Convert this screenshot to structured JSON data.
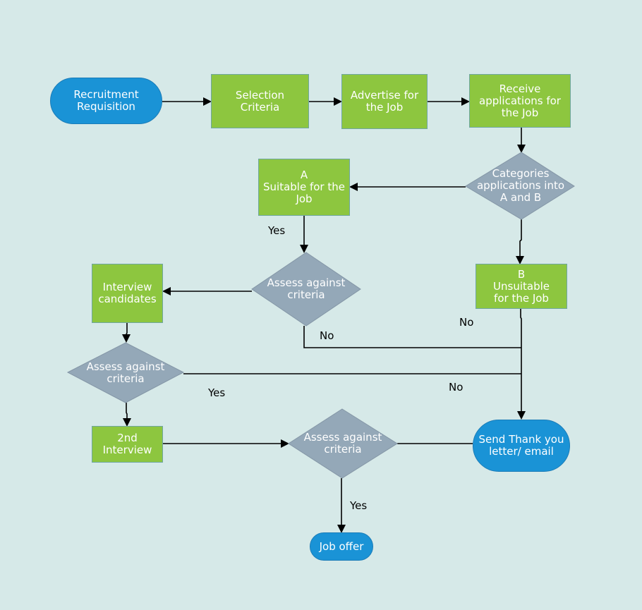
{
  "colors": {
    "background": "#d6e9e8",
    "process": "#8dc63f",
    "terminal": "#1a93d6",
    "decision": "#94a8b8",
    "connector": "#000000"
  },
  "nodes": {
    "recruitment_requisition": "Recruitment\nRequisition",
    "selection_criteria": "Selection\nCriteria",
    "advertise": "Advertise for\nthe Job",
    "receive_applications": "Receive\napplications for\nthe Job",
    "categorise": "Categories\napplications into\nA and B",
    "suitable_a": "A\nSuitable for the\nJob",
    "unsuitable_b": "B\nUnsuitable\nfor the Job",
    "assess_1": "Assess against\ncriteria",
    "interview_candidates": "Interview\ncandidates",
    "assess_2": "Assess against\ncriteria",
    "second_interview": "2nd\nInterview",
    "assess_3": "Assess against\ncriteria",
    "send_thank_you": "Send Thank you\nletter/ email",
    "job_offer": "Job offer"
  },
  "edge_labels": {
    "yes_suitable": "Yes",
    "no_assess_1": "No",
    "no_unsuitable": "No",
    "yes_assess_2": "Yes",
    "no_assess_2": "No",
    "yes_assess_3": "Yes"
  }
}
